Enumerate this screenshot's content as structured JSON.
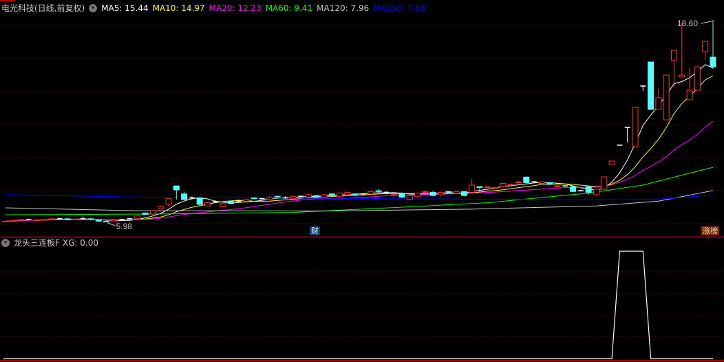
{
  "header": {
    "title": "电光科技(日线,前复权)",
    "ma": [
      {
        "label": "MA5: 15.44",
        "color": "#ffffff"
      },
      {
        "label": "MA10: 14.97",
        "color": "#ffff00"
      },
      {
        "label": "MA20: 12.23",
        "color": "#ff00ff"
      },
      {
        "label": "MA60: 9.41",
        "color": "#00ff00"
      },
      {
        "label": "MA120: 7.96",
        "color": "#c8c8c8"
      },
      {
        "label": "MA250: 7.68",
        "color": "#0000ff"
      }
    ]
  },
  "indicator": {
    "title": "龙头三连板F",
    "value_label": "XG: 0.00"
  },
  "badges": {
    "finance": "财",
    "limit_up": "涨榜"
  },
  "colors": {
    "up": "#ff3232",
    "down": "#54ffff",
    "flat": "#ffffff",
    "grid": "#8b0000",
    "divider": "#c80000"
  },
  "chart_data": [
    {
      "type": "candlestick",
      "title": "电光科技(日线,前复权)",
      "ylim": [
        5.98,
        18.6
      ],
      "annotations": {
        "high": "18.60",
        "low": "5.98",
        "high_index": 91,
        "low_index": 13
      },
      "ohlc": [
        [
          6.0,
          6.05,
          5.99,
          6.05
        ],
        [
          6.05,
          6.1,
          6.0,
          6.08
        ],
        [
          6.1,
          6.2,
          6.05,
          6.15
        ],
        [
          6.15,
          6.2,
          6.1,
          6.15
        ],
        [
          6.1,
          6.15,
          6.05,
          6.12
        ],
        [
          6.12,
          6.18,
          6.08,
          6.15
        ],
        [
          6.15,
          6.2,
          6.1,
          6.2
        ],
        [
          6.2,
          6.25,
          6.15,
          6.2
        ],
        [
          6.2,
          6.22,
          6.1,
          6.15
        ],
        [
          6.15,
          6.2,
          6.1,
          6.18
        ],
        [
          6.2,
          6.35,
          6.15,
          6.2
        ],
        [
          6.2,
          6.25,
          6.1,
          6.15
        ],
        [
          6.12,
          6.15,
          6.0,
          6.05
        ],
        [
          6.05,
          6.1,
          5.98,
          6.0
        ],
        [
          6.0,
          6.15,
          5.99,
          6.1
        ],
        [
          6.15,
          6.2,
          6.1,
          6.15
        ],
        [
          6.2,
          6.25,
          6.15,
          6.2
        ],
        [
          6.2,
          6.4,
          6.2,
          6.38
        ],
        [
          6.55,
          6.6,
          6.45,
          6.47
        ],
        [
          6.5,
          6.75,
          6.45,
          6.7
        ],
        [
          6.85,
          7.0,
          6.85,
          6.95
        ],
        [
          7.1,
          7.5,
          6.97,
          7.45
        ],
        [
          8.25,
          8.25,
          7.4,
          8.0
        ],
        [
          7.75,
          7.9,
          7.35,
          7.4
        ],
        [
          7.5,
          7.6,
          7.4,
          7.5
        ],
        [
          7.5,
          7.55,
          7.0,
          7.1
        ],
        [
          7.0,
          7.25,
          7.0,
          7.2
        ],
        [
          7.25,
          7.35,
          7.2,
          7.25
        ],
        [
          6.95,
          7.2,
          6.9,
          7.15
        ],
        [
          7.3,
          7.35,
          7.1,
          7.15
        ],
        [
          7.3,
          7.4,
          7.25,
          7.3
        ],
        [
          7.3,
          7.45,
          7.2,
          7.4
        ],
        [
          7.5,
          7.55,
          7.4,
          7.45
        ],
        [
          7.45,
          7.5,
          7.4,
          7.45
        ],
        [
          7.4,
          7.6,
          7.35,
          7.55
        ],
        [
          7.6,
          7.65,
          7.5,
          7.55
        ],
        [
          7.5,
          7.6,
          7.45,
          7.5
        ],
        [
          7.45,
          7.65,
          7.4,
          7.6
        ],
        [
          7.6,
          7.65,
          7.55,
          7.6
        ],
        [
          7.55,
          7.75,
          7.5,
          7.7
        ],
        [
          7.65,
          7.7,
          7.5,
          7.55
        ],
        [
          7.55,
          7.75,
          7.5,
          7.7
        ],
        [
          7.75,
          7.8,
          7.6,
          7.65
        ],
        [
          7.6,
          7.85,
          7.6,
          7.8
        ],
        [
          7.7,
          7.9,
          7.65,
          7.85
        ],
        [
          7.75,
          7.8,
          7.6,
          7.7
        ],
        [
          7.75,
          7.8,
          7.65,
          7.75
        ],
        [
          7.75,
          7.95,
          7.7,
          7.9
        ],
        [
          7.95,
          8.05,
          7.85,
          7.9
        ],
        [
          7.85,
          7.9,
          7.75,
          7.85
        ],
        [
          7.7,
          7.8,
          7.6,
          7.75
        ],
        [
          7.75,
          7.85,
          7.5,
          7.55
        ],
        [
          7.4,
          7.7,
          7.35,
          7.65
        ],
        [
          7.6,
          7.85,
          7.55,
          7.8
        ],
        [
          7.85,
          7.95,
          7.8,
          7.9
        ],
        [
          7.85,
          7.95,
          7.6,
          7.65
        ],
        [
          7.7,
          7.9,
          7.6,
          7.85
        ],
        [
          7.9,
          7.95,
          7.8,
          7.85
        ],
        [
          7.8,
          7.95,
          7.75,
          7.9
        ],
        [
          7.9,
          7.9,
          7.6,
          7.65
        ],
        [
          7.85,
          8.7,
          7.85,
          8.3
        ],
        [
          8.2,
          8.2,
          7.9,
          8.15
        ],
        [
          8.15,
          8.2,
          8.1,
          8.2
        ],
        [
          8.1,
          8.2,
          8.05,
          8.15
        ],
        [
          8.2,
          8.45,
          8.1,
          8.4
        ],
        [
          8.3,
          8.4,
          8.2,
          8.35
        ],
        [
          8.45,
          8.55,
          8.4,
          8.5
        ],
        [
          8.8,
          8.85,
          8.4,
          8.45
        ],
        [
          8.5,
          8.55,
          8.45,
          8.5
        ],
        [
          8.4,
          8.55,
          8.35,
          8.5
        ],
        [
          8.45,
          8.5,
          8.3,
          8.35
        ],
        [
          8.2,
          8.3,
          8.15,
          8.25
        ],
        [
          8.25,
          8.3,
          8.2,
          8.25
        ],
        [
          8.2,
          8.25,
          7.85,
          7.9
        ],
        [
          7.95,
          8.0,
          7.9,
          7.95
        ],
        [
          8.2,
          8.25,
          7.7,
          7.85
        ],
        [
          7.7,
          8.04,
          7.7,
          8.04
        ],
        [
          8.04,
          8.81,
          8.04,
          8.81
        ],
        [
          9.58,
          9.8,
          9.58,
          9.8
        ],
        [
          10.79,
          10.79,
          10.79,
          10.79
        ],
        [
          11.9,
          11.9,
          10.96,
          11.9
        ],
        [
          10.7,
          13.15,
          10.7,
          13.15
        ],
        [
          14.48,
          14.48,
          14.18,
          14.48
        ],
        [
          15.98,
          15.98,
          13.02,
          13.02
        ],
        [
          13.02,
          14.31,
          13.02,
          13.75
        ],
        [
          12.37,
          15.16,
          12.37,
          15.16
        ],
        [
          16.07,
          16.71,
          14.39,
          16.71
        ],
        [
          15.04,
          18.43,
          15.04,
          15.16
        ],
        [
          13.62,
          15.64,
          13.62,
          14.22
        ],
        [
          14.22,
          15.68,
          14.22,
          15.68
        ],
        [
          16.62,
          17.27,
          16.1,
          17.27
        ],
        [
          16.28,
          18.6,
          15.55,
          15.68
        ]
      ],
      "computed_ma": [
        {
          "name": "MA5",
          "period": 5,
          "color": "#ffffff"
        },
        {
          "name": "MA10",
          "period": 10,
          "color": "#ffff00"
        },
        {
          "name": "MA20",
          "period": 20,
          "color": "#ff00ff"
        }
      ],
      "anchored_ma": [
        {
          "name": "MA60",
          "color": "#00ff00",
          "points": [
            [
              0,
              6.45
            ],
            [
              20,
              6.5
            ],
            [
              37,
              6.6
            ],
            [
              50,
              6.9
            ],
            [
              62,
              7.2
            ],
            [
              75,
              7.8
            ],
            [
              82,
              8.3
            ],
            [
              91,
              9.41
            ]
          ]
        },
        {
          "name": "MA120",
          "color": "#c8c8c8",
          "points": [
            [
              0,
              6.88
            ],
            [
              17,
              6.7
            ],
            [
              40,
              6.68
            ],
            [
              60,
              6.8
            ],
            [
              76,
              7.0
            ],
            [
              84,
              7.3
            ],
            [
              91,
              7.96
            ]
          ]
        },
        {
          "name": "MA250",
          "color": "#0000ff",
          "points": [
            [
              0,
              7.7
            ],
            [
              17,
              7.55
            ],
            [
              40,
              7.48
            ],
            [
              60,
              7.42
            ],
            [
              80,
              7.38
            ],
            [
              85,
              7.45
            ],
            [
              91,
              7.68
            ]
          ]
        }
      ]
    },
    {
      "type": "line",
      "title": "龙头三连板F",
      "series": [
        {
          "name": "XG",
          "color": "#ffffff",
          "values": [
            0,
            0,
            0,
            0,
            0,
            0,
            0,
            0,
            0,
            0,
            0,
            0,
            0,
            0,
            0,
            0,
            0,
            0,
            0,
            0,
            0,
            0,
            0,
            0,
            0,
            0,
            0,
            0,
            0,
            0,
            0,
            0,
            0,
            0,
            0,
            0,
            0,
            0,
            0,
            0,
            0,
            0,
            0,
            0,
            0,
            0,
            0,
            0,
            0,
            0,
            0,
            0,
            0,
            0,
            0,
            0,
            0,
            0,
            0,
            0,
            0,
            0,
            0,
            0,
            0,
            0,
            0,
            0,
            0,
            0,
            0,
            0,
            0,
            0,
            0,
            0,
            0,
            0,
            0,
            1,
            1,
            1,
            1,
            0,
            0,
            0,
            0,
            0,
            0,
            0,
            0,
            0
          ]
        }
      ],
      "ylim": [
        0,
        1
      ]
    }
  ]
}
